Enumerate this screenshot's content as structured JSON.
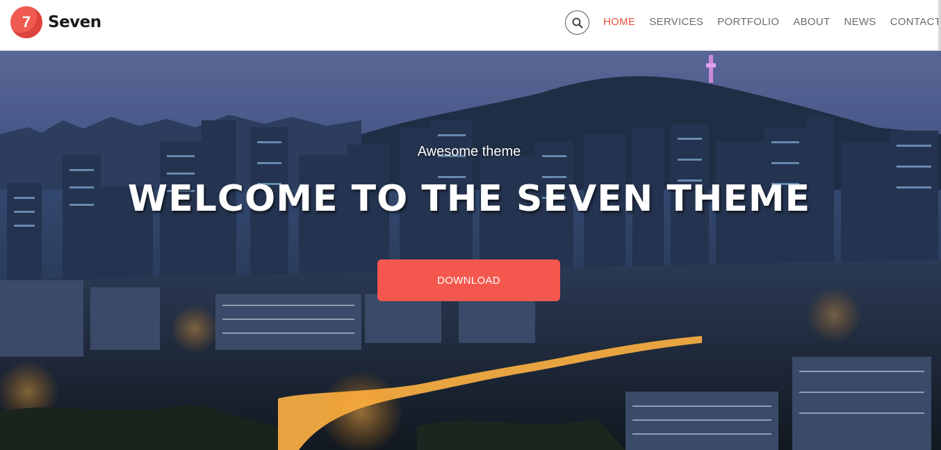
{
  "brand": {
    "logo_text": "7",
    "name": "Seven"
  },
  "nav": {
    "search_icon": "search-icon",
    "links": [
      {
        "label": "HOME",
        "active": true
      },
      {
        "label": "SERVICES",
        "active": false
      },
      {
        "label": "PORTFOLIO",
        "active": false
      },
      {
        "label": "ABOUT",
        "active": false
      },
      {
        "label": "NEWS",
        "active": false
      },
      {
        "label": "CONTACT",
        "active": false
      }
    ]
  },
  "hero": {
    "subtitle": "Awesome theme",
    "title": "WELCOME TO THE SEVEN THEME",
    "button_label": "DOWNLOAD",
    "background": "night city skyline with mountain and tower"
  },
  "colors": {
    "accent": "#f4574d",
    "nav_active": "#e84c3d",
    "nav_text": "#6b6b6b"
  }
}
